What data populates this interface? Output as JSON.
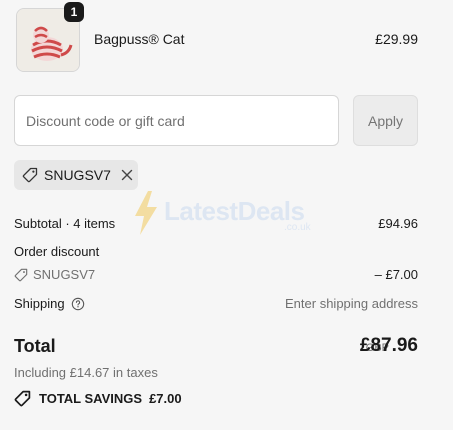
{
  "product": {
    "name": "Bagpuss® Cat",
    "price": "£29.99",
    "quantity": "1"
  },
  "discount": {
    "placeholder": "Discount code or gift card",
    "apply_label": "Apply",
    "applied_code": "SNUGSV7"
  },
  "summary": {
    "subtotal_label": "Subtotal · 4 items",
    "subtotal_value": "£94.96",
    "order_discount_label": "Order discount",
    "order_discount_code": "SNUGSV7",
    "order_discount_value": "– £7.00",
    "shipping_label": "Shipping",
    "shipping_value": "Enter shipping address"
  },
  "total": {
    "label": "Total",
    "currency": "GBP",
    "amount": "£87.96",
    "taxes_note": "Including £14.67 in taxes",
    "savings_label": "TOTAL SAVINGS",
    "savings_value": "£7.00"
  },
  "watermark": {
    "brand": "LatestDeals",
    "sub": ".co.uk"
  },
  "colors": {
    "background": "#f6f6f6",
    "text": "#1a1a1a",
    "muted": "#707070",
    "chip": "#e7e7e7",
    "watermark": "#c9daf0"
  }
}
